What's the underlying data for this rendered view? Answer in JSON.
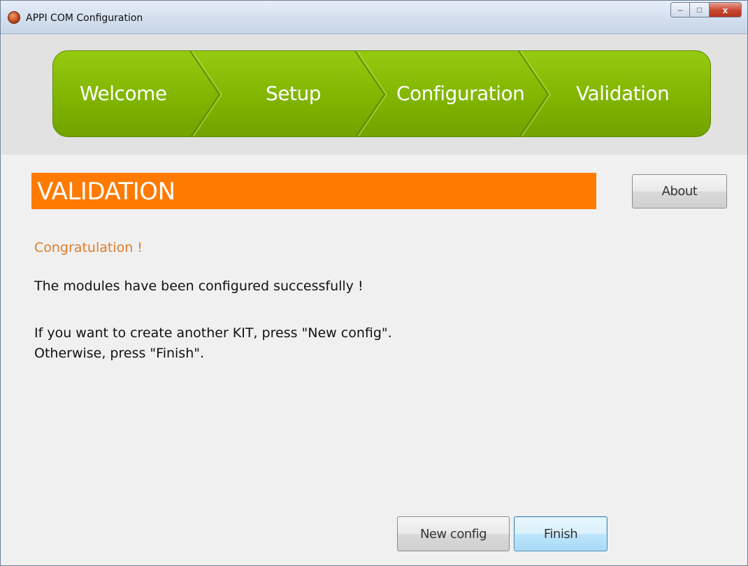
{
  "window": {
    "title": "APPI COM Configuration",
    "controls": {
      "minimize": "–",
      "maximize": "□",
      "close": "x"
    }
  },
  "steps": [
    {
      "label": "Welcome"
    },
    {
      "label": "Setup"
    },
    {
      "label": "Configuration"
    },
    {
      "label": "Validation"
    }
  ],
  "section": {
    "title": "VALIDATION",
    "about_label": "About"
  },
  "body": {
    "congratulation": "Congratulation !",
    "success_line": "The modules have been configured successfully !",
    "instruction_line1": "If you want to create another KIT, press \"New config\".",
    "instruction_line2": "Otherwise, press \"Finish\"."
  },
  "footer": {
    "new_config_label": "New config",
    "finish_label": "Finish"
  },
  "colors": {
    "accent_orange": "#ff7a00",
    "steps_green": "#7fb300",
    "congrats_text": "#e07c2a"
  },
  "icons": {
    "app": "app-logo-icon",
    "minimize": "minimize-icon",
    "maximize": "maximize-icon",
    "close": "close-icon"
  }
}
